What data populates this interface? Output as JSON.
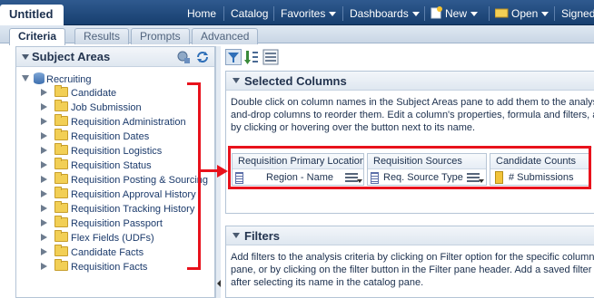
{
  "app": {
    "title": "Untitled"
  },
  "nav": {
    "items": [
      {
        "label": "Home"
      },
      {
        "label": "Catalog"
      },
      {
        "label": "Favorites"
      },
      {
        "label": "Dashboards"
      },
      {
        "label": "New"
      },
      {
        "label": "Open"
      },
      {
        "label": "Signed"
      }
    ]
  },
  "tabs": [
    {
      "label": "Criteria"
    },
    {
      "label": "Results"
    },
    {
      "label": "Prompts"
    },
    {
      "label": "Advanced"
    }
  ],
  "subject_areas": {
    "title": "Subject Areas",
    "root": "Recruiting",
    "folders": [
      "Candidate",
      "Job Submission",
      "Requisition Administration",
      "Requisition Dates",
      "Requisition Logistics",
      "Requisition Status",
      "Requisition Posting & Sourcing",
      "Requisition Approval History",
      "Requisition Tracking History",
      "Requisition Passport",
      "Flex Fields (UDFs)",
      "Candidate Facts",
      "Requisition Facts"
    ]
  },
  "selected_columns": {
    "title": "Selected Columns",
    "instructions": [
      "Double click on column names in the Subject Areas pane to add them to the analysis",
      "and-drop columns to reorder them. Edit a column's properties, formula and filters, a",
      "by clicking or hovering over the button next to its name."
    ],
    "columns": [
      {
        "header": "Requisition Primary Location",
        "name": "Region - Name"
      },
      {
        "header": "Requisition Sources",
        "name": "Req. Source Type"
      },
      {
        "header": "Candidate Counts",
        "name": "# Submissions"
      }
    ]
  },
  "filters": {
    "title": "Filters",
    "instructions": [
      "Add filters to the analysis criteria by clicking on Filter option for the specific column in",
      "pane, or by clicking on the filter button in the Filter pane header. Add a saved filter b",
      "after selecting its name in the catalog pane."
    ]
  },
  "icons": {
    "tree_expanded": "expanded-triangle-icon",
    "tree_collapsed": "collapsed-triangle-icon",
    "folder": "folder-icon",
    "subject_area": "database-icon",
    "add": "add-subject-area-icon",
    "refresh": "refresh-icon",
    "filter": "filter-icon",
    "sort": "sort-icon",
    "sql": "sql-icon"
  },
  "colors": {
    "topbar": "#1f4a7f",
    "annotation": "#e8121c",
    "folder": "#f2cf55",
    "measure": "#f2c43a"
  }
}
